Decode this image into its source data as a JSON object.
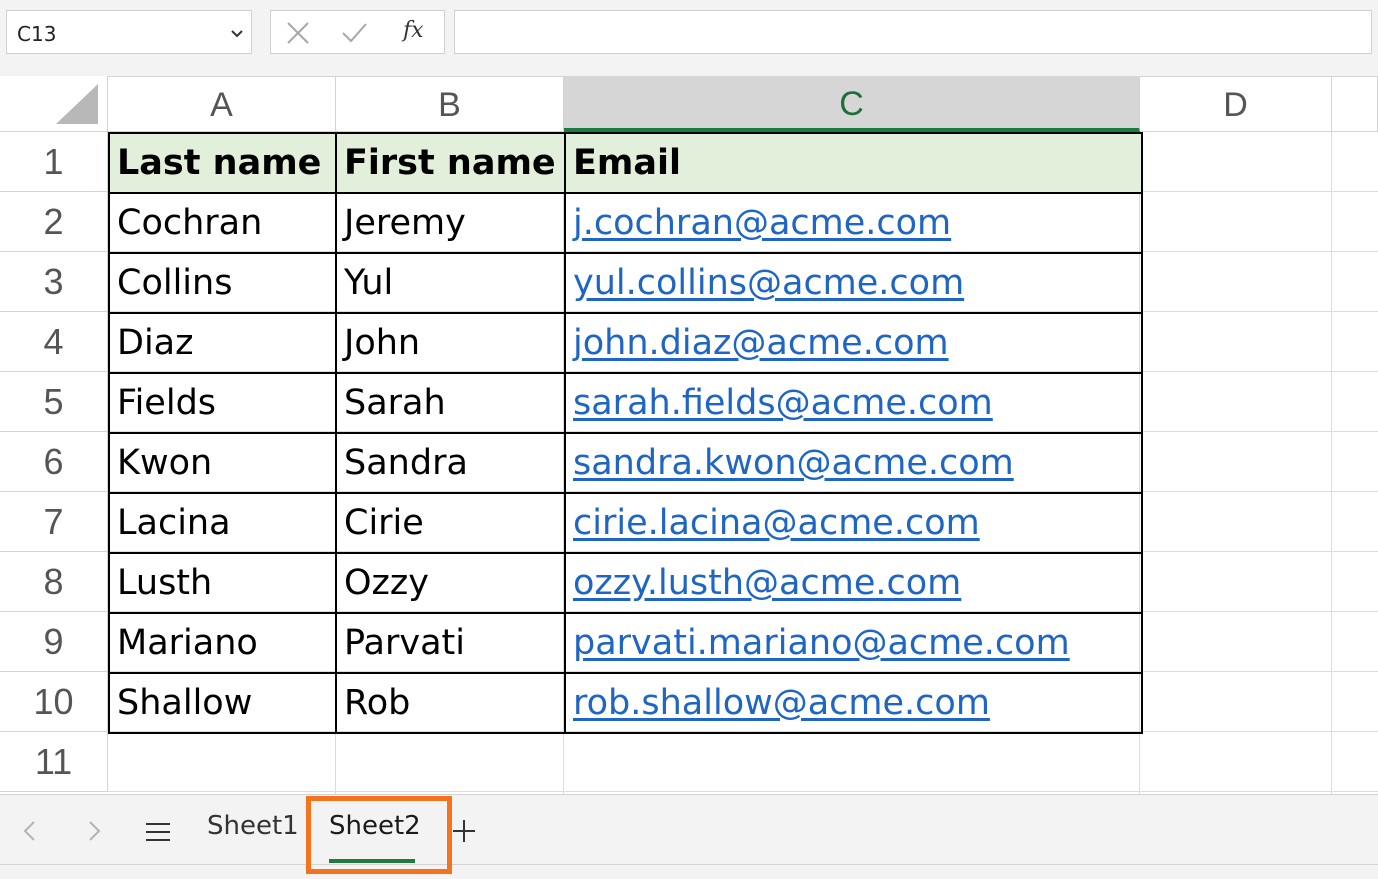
{
  "formula_bar": {
    "name_box": "C13",
    "fx_label": "fx",
    "formula": ""
  },
  "columns": [
    {
      "label": "A",
      "selected": false
    },
    {
      "label": "B",
      "selected": false
    },
    {
      "label": "C",
      "selected": true
    },
    {
      "label": "D",
      "selected": false
    }
  ],
  "rows": [
    "1",
    "2",
    "3",
    "4",
    "5",
    "6",
    "7",
    "8",
    "9",
    "10",
    "11"
  ],
  "table": {
    "headers": [
      "Last name",
      "First name",
      "Email"
    ],
    "records": [
      [
        "Cochran",
        "Jeremy",
        "j.cochran@acme.com"
      ],
      [
        "Collins",
        "Yul",
        "yul.collins@acme.com"
      ],
      [
        "Diaz",
        "John",
        "john.diaz@acme.com"
      ],
      [
        "Fields",
        "Sarah",
        "sarah.fields@acme.com"
      ],
      [
        "Kwon",
        "Sandra",
        "sandra.kwon@acme.com"
      ],
      [
        "Lacina",
        "Cirie",
        "cirie.lacina@acme.com"
      ],
      [
        "Lusth",
        "Ozzy",
        "ozzy.lusth@acme.com"
      ],
      [
        "Mariano",
        "Parvati",
        "parvati.mariano@acme.com"
      ],
      [
        "Shallow",
        "Rob",
        "rob.shallow@acme.com"
      ]
    ]
  },
  "sheets": {
    "tabs": [
      "Sheet1",
      "Sheet2"
    ],
    "active": "Sheet2"
  },
  "colors": {
    "header_fill": "#e2efda",
    "link": "#1f66c4",
    "accent_green": "#1e7a40",
    "highlight": "#f4731f"
  }
}
